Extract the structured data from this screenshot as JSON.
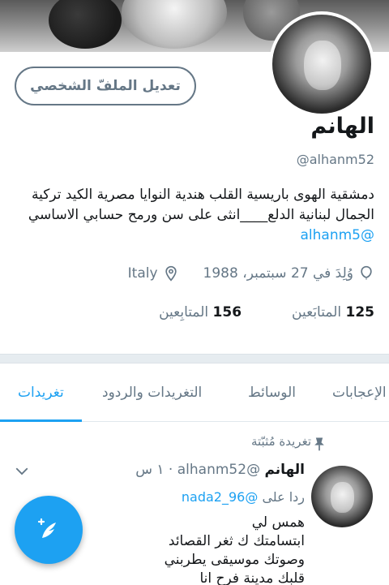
{
  "profile": {
    "edit_button_label": "تعديل الملفّ الشخصي",
    "name": "الهانم",
    "handle": "@alhanm52",
    "bio_text": "دمشقية الهوى باريسية القلب هندية النوايا مصرية الكيد تركية الجمال لبنانية الدلع____انثى على سن ورمح حسابي الاساسي",
    "bio_mention": "@alhanm5",
    "location": "Italy",
    "birthdate": "وُلِدَ في 27 سبتمبر، 1988",
    "following_count": "125",
    "following_label": "المتابَعين",
    "followers_count": "156",
    "followers_label": "المتابِعين"
  },
  "tabs": {
    "tweets": "تغريدات",
    "tweets_replies": "التغريدات والردود",
    "media": "الوسائط",
    "likes": "الإعجابات"
  },
  "tweet": {
    "pinned_label": "تغريدة مُثبّتة",
    "author_name": "الهانم",
    "author_handle": "@alhanm52",
    "time": "· ١ س",
    "reply_prefix": "ردا على",
    "reply_mention": "@nada2_96",
    "body": "همس لي\nابتسامتك ك ثغر القصائد\nوصوتك موسيقى يطربني\nقلبك مدينة فرح انا"
  },
  "icons": {
    "location": "location-pin-icon",
    "birthday": "balloon-icon",
    "pin": "pin-icon",
    "more": "chevron-down-icon",
    "compose": "compose-feather-icon"
  },
  "colors": {
    "accent": "#1da1f2",
    "muted": "#657786",
    "divider": "#e6ecf0"
  }
}
